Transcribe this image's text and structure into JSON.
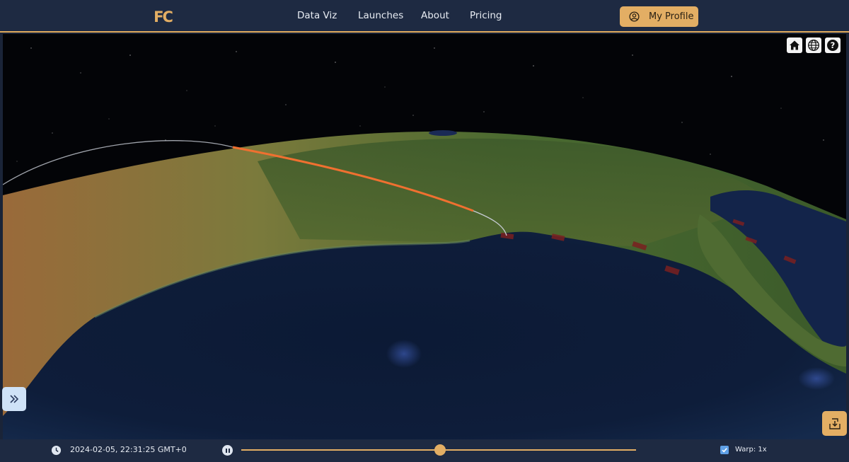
{
  "nav": {
    "logo_text": "FC",
    "links": [
      "Data Viz",
      "Launches",
      "About",
      "Pricing"
    ],
    "profile_label": "My Profile"
  },
  "toolbar": {
    "icons": [
      "home-icon",
      "globe-icon",
      "help-icon"
    ]
  },
  "timeline": {
    "datetime": "2024-02-05, 22:31:25 GMT+0",
    "progress": 0.503,
    "warp_checked": true,
    "warp_label": "Warp: 1x"
  },
  "colors": {
    "accent": "#e3ae64",
    "navbar": "#1e2a42",
    "trajectory": "#f07030",
    "side_toggle": "#cfe2f7"
  }
}
